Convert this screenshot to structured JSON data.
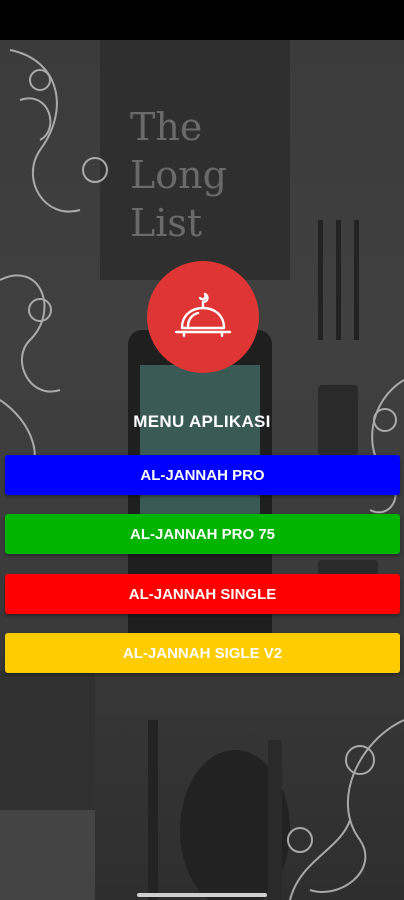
{
  "menu": {
    "title": "MENU APLIKASI",
    "logo_icon": "mosque-dome-icon",
    "logo_color": "#e03535",
    "buttons": [
      {
        "label": "AL-JANNAH PRO",
        "color": "#0000ff"
      },
      {
        "label": "AL-JANNAH PRO 75",
        "color": "#00b400"
      },
      {
        "label": "AL-JANNAH SINGLE",
        "color": "#ff0000"
      },
      {
        "label": "AL-JANNAH SIGLE V2",
        "color": "#ffcc00"
      }
    ]
  },
  "background": {
    "book_title_line1": "The",
    "book_title_line2": "Long",
    "book_title_line3": "List"
  }
}
